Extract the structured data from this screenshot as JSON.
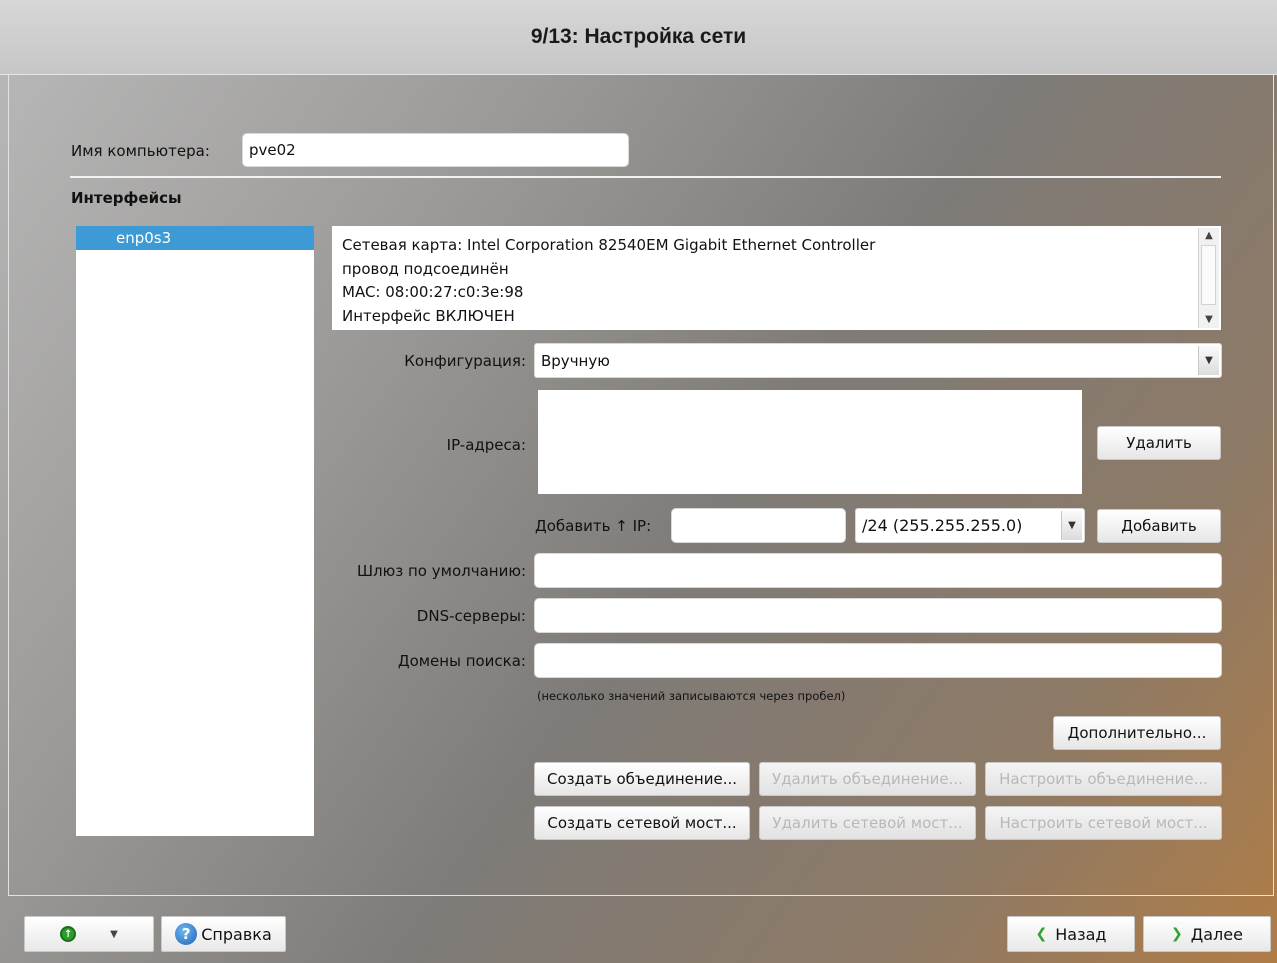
{
  "window": {
    "title": "9/13: Настройка сети"
  },
  "hostname": {
    "label": "Имя компьютера:",
    "value": "pve02"
  },
  "interfaces": {
    "heading": "Интерфейсы",
    "items": [
      {
        "label": "enp0s3",
        "selected": true
      }
    ],
    "info_lines": [
      "Сетевая карта: Intel Corporation 82540EM Gigabit Ethernet Controller",
      "провод подсоединён",
      "MAC: 08:00:27:c0:3e:98",
      "Интерфейс ВКЛЮЧЕН"
    ]
  },
  "config": {
    "label": "Конфигурация:",
    "value": "Вручную"
  },
  "ip": {
    "label": "IP-адреса:",
    "addresses": [],
    "delete_label": "Удалить",
    "add_label": "Добавить ↑ IP:",
    "add_value": "",
    "mask_value": "/24 (255.255.255.0)",
    "add_button": "Добавить"
  },
  "gateway": {
    "label": "Шлюз по умолчанию:",
    "value": ""
  },
  "dns": {
    "label": "DNS-серверы:",
    "value": ""
  },
  "search": {
    "label": "Домены поиска:",
    "value": ""
  },
  "hint": "(несколько значений записываются через пробел)",
  "buttons": {
    "advanced": "Дополнительно...",
    "create_bond": "Создать объединение...",
    "delete_bond": "Удалить объединение...",
    "configure_bond": "Настроить объединение...",
    "create_bridge": "Создать сетевой мост...",
    "delete_bridge": "Удалить сетевой мост...",
    "configure_bridge": "Настроить сетевой мост..."
  },
  "footer": {
    "help": "Справка",
    "back": "Назад",
    "next": "Далее"
  },
  "icons": [
    "green-circle-icon",
    "dropdown-arrow-icon",
    "help-icon",
    "back-chevron-icon",
    "next-chevron-icon"
  ]
}
